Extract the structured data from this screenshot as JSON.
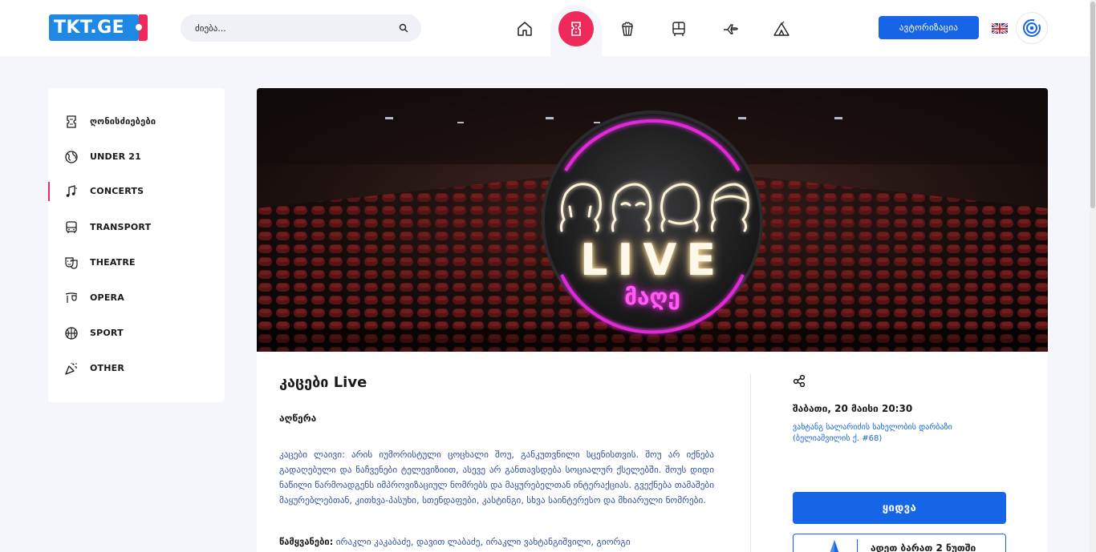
{
  "header": {
    "logo_text": "TKT.GE",
    "search_placeholder": "ძიება...",
    "login_label": "ავტორიზაცია",
    "nav": [
      "home",
      "events",
      "cinema",
      "transport",
      "flights",
      "camping"
    ],
    "language": "EN"
  },
  "sidebar": {
    "items": [
      {
        "label": "ღონისძიებები",
        "icon": "ticket-icon"
      },
      {
        "label": "UNDER 21",
        "icon": "globe-icon"
      },
      {
        "label": "CONCERTS",
        "icon": "music-icon",
        "active": true
      },
      {
        "label": "TRANSPORT",
        "icon": "bus-icon"
      },
      {
        "label": "THEATRE",
        "icon": "theatre-masks-icon"
      },
      {
        "label": "OPERA",
        "icon": "opera-icon"
      },
      {
        "label": "SPORT",
        "icon": "basketball-icon"
      },
      {
        "label": "OTHER",
        "icon": "confetti-icon"
      }
    ]
  },
  "banner": {
    "sign_main": "LIVE",
    "sign_sub": "მაღე"
  },
  "event": {
    "title": "კაცები Live",
    "description_heading": "აღწერა",
    "description": "კაცები ლაივი: არის იუმორისტული ცოცხალი შოუ, განკუთვნილი სცენისთვის. შოუ არ იქნება გადაღებული და ნაჩვენები ტელევიზიით, ასევე არ განთავსდება სოციალურ ქსელებში. შოუს დიდი ნაწილი წარმოადგენს იმპროვიზაციულ ნომრებს და მაყურებელთან ინტერაქციას. გვექნება თამაშები მაყურებლებთან, კითხვა-პასუხი, სთენდაფები, კასტინგი, სხვა საინტერესო და მხიარული ნომრები.",
    "hosts_label": "წამყვანები:",
    "hosts": "ირაკლი კაკაბაძე, დავით ლაბაძე, ირაკლი ვახტანგიშვილი, გიორგი",
    "date": "შაბათი, 20 მაისი 20:30",
    "venue": "ვახტანგ სალარიძის სახელობის დარბაზი (ბელიაშვილის ქ. #68)",
    "buy_label": "ყიდვა",
    "promo_text": "ადეთ ბარათ 2 ნუთში"
  },
  "colors": {
    "brand_blue": "#1565e6",
    "accent_red": "#ee2a5a",
    "neon_pink": "#e02bd8",
    "page_bg": "#f4f6fb"
  }
}
